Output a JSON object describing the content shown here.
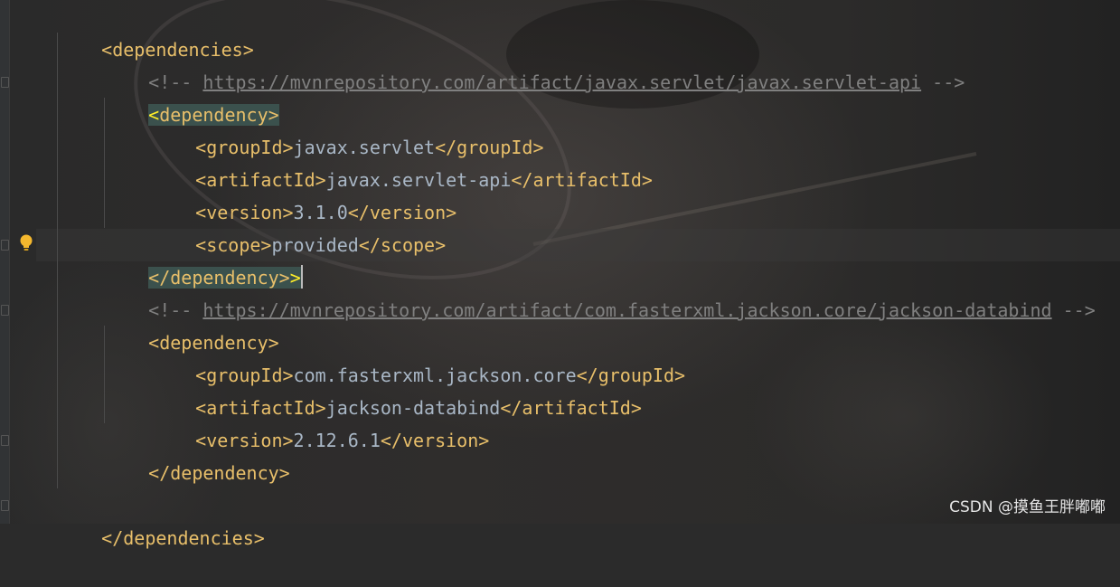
{
  "editor": {
    "lines": [
      {
        "id": "l1",
        "indent": 0,
        "tag": "<dependencies>"
      },
      {
        "id": "l2",
        "indent": 1,
        "comment_open": "<!-- ",
        "url": "https://mvnrepository.com/artifact/javax.servlet/javax.servlet-api",
        "comment_close": " -->"
      },
      {
        "id": "l3",
        "indent": 1,
        "tag_first": "<",
        "tag_rest": "dependency>"
      },
      {
        "id": "l4",
        "indent": 2,
        "open": "<groupId>",
        "value": "javax.servlet",
        "close": "</groupId>"
      },
      {
        "id": "l5",
        "indent": 2,
        "open": "<artifactId>",
        "value": "javax.servlet-api",
        "close": "</artifactId>"
      },
      {
        "id": "l6",
        "indent": 2,
        "open": "<version>",
        "value": "3.1.0",
        "close": "</version>"
      },
      {
        "id": "l7",
        "indent": 2,
        "open": "<scope>",
        "value": "provided",
        "close": "</scope>"
      },
      {
        "id": "l8",
        "indent": 1,
        "tag_rest": "</dependency>",
        "tag_last": ">"
      },
      {
        "id": "l9",
        "indent": 1,
        "comment_open": "<!-- ",
        "url": "https://mvnrepository.com/artifact/com.fasterxml.jackson.core/jackson-databind",
        "comment_close": " -->"
      },
      {
        "id": "l10",
        "indent": 1,
        "tag": "<dependency>"
      },
      {
        "id": "l11",
        "indent": 2,
        "open": "<groupId>",
        "value": "com.fasterxml.jackson.core",
        "close": "</groupId>"
      },
      {
        "id": "l12",
        "indent": 2,
        "open": "<artifactId>",
        "value": "jackson-databind",
        "close": "</artifactId>"
      },
      {
        "id": "l13",
        "indent": 2,
        "open": "<version>",
        "value": "2.12.6.1",
        "close": "</version>"
      },
      {
        "id": "l14",
        "indent": 1,
        "tag": "</dependency>"
      },
      {
        "id": "l15",
        "indent": 0,
        "tag": "</dependencies>"
      }
    ]
  },
  "icons": {
    "intention": "lightbulb-icon"
  },
  "colors": {
    "tag": "#e8bf6a",
    "text": "#a9b7c6",
    "comment": "#808080",
    "match_bg": "#3b514d"
  },
  "watermark": "CSDN @摸鱼王胖嘟嘟"
}
